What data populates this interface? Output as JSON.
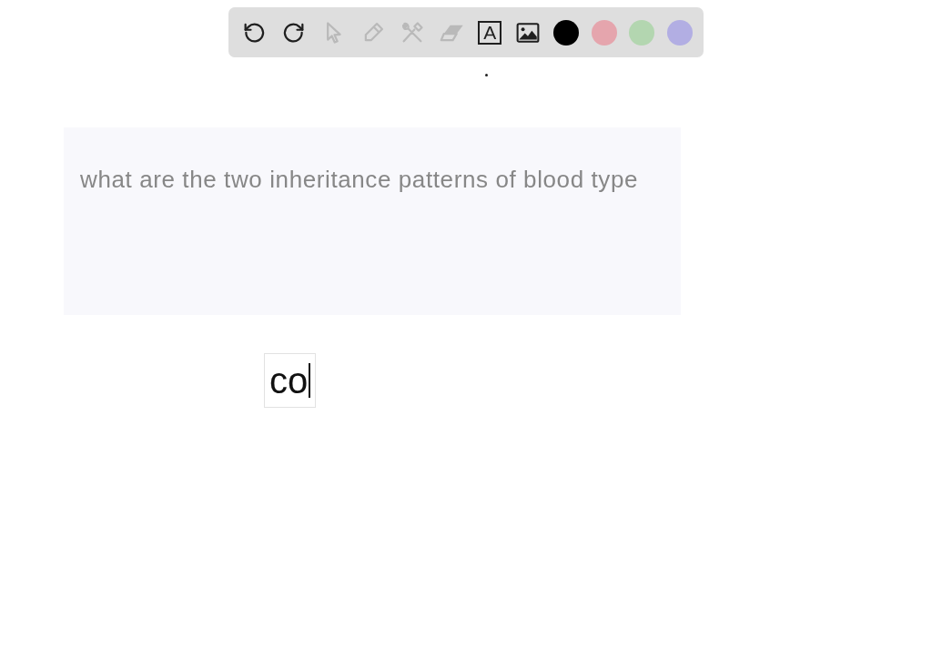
{
  "toolbar": {
    "tools": [
      {
        "kind": "undo",
        "disabled": false
      },
      {
        "kind": "redo",
        "disabled": false
      },
      {
        "kind": "pointer",
        "disabled": true
      },
      {
        "kind": "pencil",
        "disabled": true
      },
      {
        "kind": "tools",
        "disabled": true
      },
      {
        "kind": "eraser",
        "disabled": true
      },
      {
        "kind": "text",
        "label": "A",
        "disabled": false
      },
      {
        "kind": "image",
        "disabled": false
      }
    ],
    "colors": [
      {
        "color": "#000000"
      },
      {
        "color": "#e5a5ad"
      },
      {
        "color": "#b3d6b0"
      },
      {
        "color": "#b2aee3"
      }
    ]
  },
  "question": {
    "text": "what are the two inheritance patterns of blood type"
  },
  "text_box": {
    "value": "co"
  }
}
